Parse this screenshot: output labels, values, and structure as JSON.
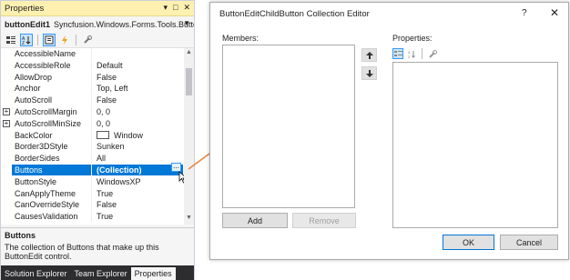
{
  "properties": {
    "title": "Properties",
    "title_buttons": [
      "▾",
      "□",
      "✕"
    ],
    "object_name": "buttonEdit1",
    "object_type": "Syncfusion.Windows.Forms.Tools.Button",
    "toolbar_icons": [
      "categorized-icon",
      "alphabetical-icon",
      "properties-icon",
      "events-icon",
      "property-pages-icon"
    ],
    "rows": [
      {
        "name": "AccessibleName",
        "value": "",
        "expand": false
      },
      {
        "name": "AccessibleRole",
        "value": "Default",
        "expand": false
      },
      {
        "name": "AllowDrop",
        "value": "False",
        "expand": false
      },
      {
        "name": "Anchor",
        "value": "Top, Left",
        "expand": false
      },
      {
        "name": "AutoScroll",
        "value": "False",
        "expand": false
      },
      {
        "name": "AutoScrollMargin",
        "value": "0, 0",
        "expand": true
      },
      {
        "name": "AutoScrollMinSize",
        "value": "0, 0",
        "expand": true
      },
      {
        "name": "BackColor",
        "value": "Window",
        "expand": false,
        "swatch": "#ffffff"
      },
      {
        "name": "Border3DStyle",
        "value": "Sunken",
        "expand": false
      },
      {
        "name": "BorderSides",
        "value": "All",
        "expand": false
      },
      {
        "name": "Buttons",
        "value": "(Collection)",
        "expand": false,
        "selected": true
      },
      {
        "name": "ButtonStyle",
        "value": "WindowsXP",
        "expand": false
      },
      {
        "name": "CanApplyTheme",
        "value": "True",
        "expand": false
      },
      {
        "name": "CanOverrideStyle",
        "value": "False",
        "expand": false
      },
      {
        "name": "CausesValidation",
        "value": "True",
        "expand": false
      }
    ],
    "ellipsis": "...",
    "description_title": "Buttons",
    "description_text": "The collection of Buttons that make up this ButtonEdit control.",
    "tabs": [
      "Solution Explorer",
      "Team Explorer",
      "Properties"
    ],
    "active_tab": "Properties"
  },
  "dialog": {
    "title": "ButtonEditChildButton Collection Editor",
    "help": "?",
    "close": "✕",
    "members_label": "Members:",
    "properties_label": "Properties:",
    "add_label": "Add",
    "remove_label": "Remove",
    "ok_label": "OK",
    "cancel_label": "Cancel"
  },
  "colors": {
    "arrow": "#e8853c",
    "selection": "#0078d7",
    "title_bar": "#fdf0b1"
  }
}
